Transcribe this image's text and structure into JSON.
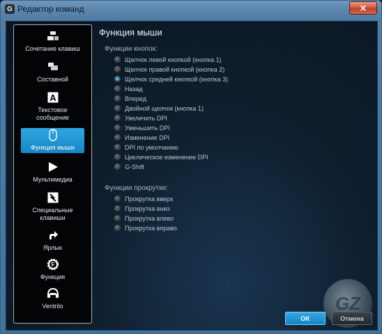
{
  "window": {
    "title": "Редактор команд",
    "close_glyph": "✕"
  },
  "sidebar": {
    "items": [
      {
        "label": "Сочетание клавиш",
        "icon": "keyboard-shortcut-icon"
      },
      {
        "label": "Составной",
        "icon": "multikey-icon"
      },
      {
        "label": "Текстовое сообщение",
        "icon": "text-block-icon",
        "glyph": "A"
      },
      {
        "label": "Функция мыши",
        "icon": "mouse-icon",
        "selected": true
      },
      {
        "label": "Мультимедиа",
        "icon": "play-icon"
      },
      {
        "label": "Специальные клавиши",
        "icon": "special-keys-icon"
      },
      {
        "label": "Ярлык",
        "icon": "shortcut-arrow-icon"
      },
      {
        "label": "Функция",
        "icon": "gear-function-icon",
        "glyph": "F"
      },
      {
        "label": "Ventrilo",
        "icon": "ventrilo-headset-icon"
      }
    ]
  },
  "main": {
    "title": "Функция мыши",
    "button_functions": {
      "label": "Функции кнопок:",
      "options": [
        {
          "label": "Щелчок левой кнопкой (кнопка 1)",
          "checked": false
        },
        {
          "label": "Щелчок правой кнопкой (кнопка 2)",
          "checked": false
        },
        {
          "label": "Щелчок средней кнопкой (кнопка 3)",
          "checked": true
        },
        {
          "label": "Назад",
          "checked": false
        },
        {
          "label": "Вперед",
          "checked": false
        },
        {
          "label": "Двойной щелчок (кнопка 1)",
          "checked": false
        },
        {
          "label": "Увеличить DPI",
          "checked": false
        },
        {
          "label": "Уменьшить DPI",
          "checked": false
        },
        {
          "label": "Изменение DPI",
          "checked": false
        },
        {
          "label": "DPI по умолчанию",
          "checked": false
        },
        {
          "label": "Циклическое изменение DPI",
          "checked": false
        },
        {
          "label": "G-Shift",
          "checked": false
        }
      ]
    },
    "scroll_functions": {
      "label": "Функции прокрутки:",
      "options": [
        {
          "label": "Прокрутка вверх",
          "checked": false
        },
        {
          "label": "Прокрутка вниз",
          "checked": false
        },
        {
          "label": "Прокрутка влево",
          "checked": false
        },
        {
          "label": "Прокрутка вправо",
          "checked": false
        }
      ]
    }
  },
  "footer": {
    "ok_label": "OK",
    "cancel_label": "Отмена"
  },
  "watermark": {
    "text": "GZ"
  },
  "colors": {
    "accent": "#1e94d4",
    "selected_radio": "#3fb6ff",
    "frame": "#4f7da6"
  }
}
